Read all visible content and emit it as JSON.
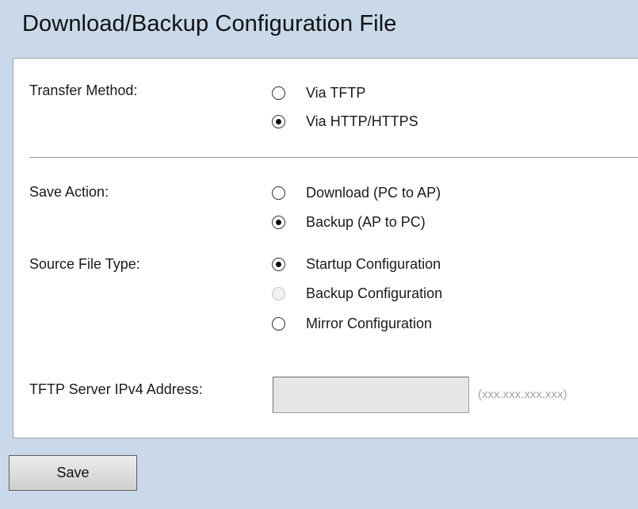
{
  "page": {
    "title": "Download/Backup Configuration File"
  },
  "transfer_method": {
    "label": "Transfer Method:",
    "options": [
      {
        "label": "Via TFTP",
        "checked": false,
        "disabled": false
      },
      {
        "label": "Via HTTP/HTTPS",
        "checked": true,
        "disabled": false
      }
    ]
  },
  "save_action": {
    "label": "Save Action:",
    "options": [
      {
        "label": "Download (PC to AP)",
        "checked": false,
        "disabled": false
      },
      {
        "label": "Backup (AP to PC)",
        "checked": true,
        "disabled": false
      }
    ]
  },
  "source_file_type": {
    "label": "Source File Type:",
    "options": [
      {
        "label": "Startup Configuration",
        "checked": true,
        "disabled": false
      },
      {
        "label": "Backup Configuration",
        "checked": false,
        "disabled": true
      },
      {
        "label": "Mirror Configuration",
        "checked": false,
        "disabled": false
      }
    ]
  },
  "tftp_server": {
    "label": "TFTP Server IPv4 Address:",
    "value": "",
    "hint": "(xxx.xxx.xxx.xxx)",
    "disabled": true
  },
  "actions": {
    "save_label": "Save"
  }
}
